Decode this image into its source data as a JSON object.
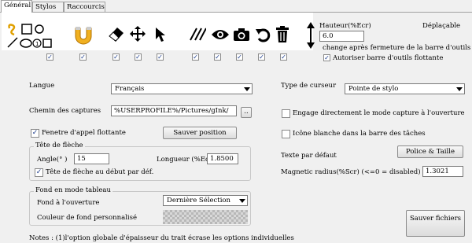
{
  "tabs": [
    "Général",
    "Stylos",
    "Raccourcis"
  ],
  "toolbar": {
    "icons": [
      "pen-select-icon",
      "rectangle-icon",
      "ellipse-icon",
      "line-icon",
      "number-icon",
      "text-icon",
      "magnet-icon",
      "eraser-icon",
      "move-icon",
      "pointer-icon",
      "hatch-icon",
      "eye-icon",
      "camera-icon",
      "undo-icon",
      "trash-icon"
    ],
    "hauteur_label": "Hauteur(%Ecr)",
    "hauteur_value": "6.0",
    "deplacable_label": "Déplaçable",
    "change_label": "change après fermeture de la barre d'outils",
    "autoriser_label": "Autoriser barre d'outils flottante",
    "autoriser_checked": true
  },
  "left": {
    "langue_label": "Langue",
    "langue_value": "Français",
    "chemin_label": "Chemin des captures",
    "chemin_value": "%USERPROFILE%/Pictures/gInk/",
    "browse_label": "..",
    "fenetre_label": "Fenetre d'appel flottante",
    "fenetre_checked": true,
    "sauver_position_label": "Sauver position",
    "fleche_group": "Tête de flèche",
    "angle_label": "Angle(° )",
    "angle_value": "15",
    "longueur_label": "Longueur (%Ecr)",
    "longueur_value": "1.8500",
    "tete_debut_label": "Tête de flèche au début par déf.",
    "tete_debut_checked": true,
    "fond_group": "Fond en mode tableau",
    "fond_ouverture_label": "Fond à l'ouverture",
    "fond_ouverture_value": "Dernière Sélection",
    "couleur_label": "Couleur de fond personnalisé"
  },
  "right": {
    "curseur_label": "Type de curseur",
    "curseur_value": "Pointe de stylo",
    "engage_label": "Engage directement le mode capture à l'ouverture",
    "icone_label": "Icône blanche dans la barre des tâches",
    "texte_label": "Texte par défaut",
    "police_label": "Police & Taille",
    "magnetic_label": "Magnetic radius(%Scr) (<=0 = disabled)",
    "magnetic_value": "1.3021",
    "sauver_fichiers_label": "Sauver fichiers"
  },
  "notes": "Notes : (1)l'option globale d'épaisseur du trait écrase les options individuelles"
}
